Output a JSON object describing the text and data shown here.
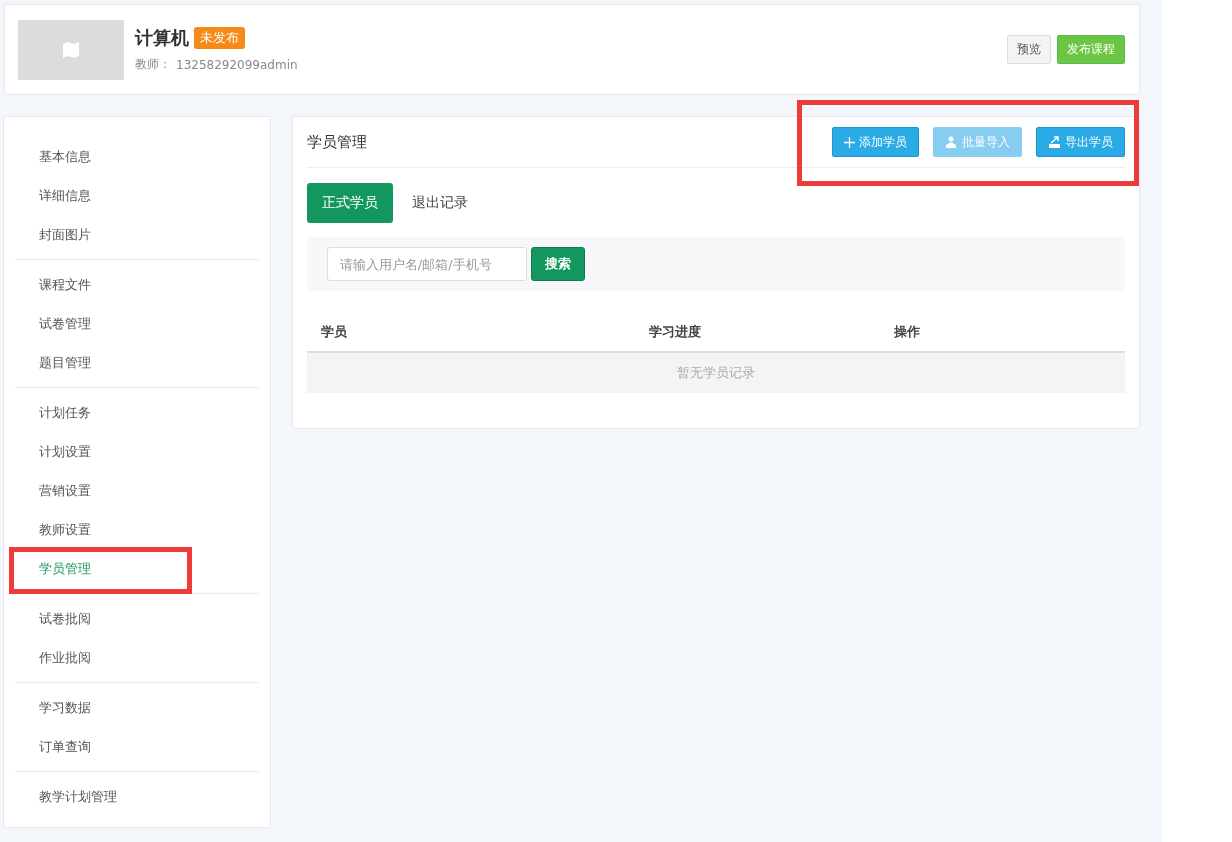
{
  "course": {
    "title": "计算机",
    "status": "未发布",
    "teacher_label": "教师：",
    "teacher": "13258292099admin"
  },
  "header_buttons": [
    {
      "label": "预览",
      "kind": "default"
    },
    {
      "label": "发布课程",
      "kind": "primary"
    }
  ],
  "sidebar": {
    "groups": [
      {
        "items": [
          {
            "label": "基本信息",
            "selected": false,
            "highlighted": false
          },
          {
            "label": "详细信息",
            "selected": false,
            "highlighted": false
          },
          {
            "label": "封面图片",
            "selected": false,
            "highlighted": false
          }
        ]
      },
      {
        "items": [
          {
            "label": "课程文件",
            "selected": false,
            "highlighted": false
          },
          {
            "label": "试卷管理",
            "selected": false,
            "highlighted": false
          },
          {
            "label": "题目管理",
            "selected": false,
            "highlighted": false
          }
        ]
      },
      {
        "items": [
          {
            "label": "计划任务",
            "selected": false,
            "highlighted": false
          },
          {
            "label": "计划设置",
            "selected": false,
            "highlighted": false
          },
          {
            "label": "营销设置",
            "selected": false,
            "highlighted": false
          },
          {
            "label": "教师设置",
            "selected": false,
            "highlighted": false
          },
          {
            "label": "学员管理",
            "selected": true,
            "highlighted": true
          }
        ]
      },
      {
        "items": [
          {
            "label": "试卷批阅",
            "selected": false,
            "highlighted": false
          },
          {
            "label": "作业批阅",
            "selected": false,
            "highlighted": false
          }
        ]
      },
      {
        "items": [
          {
            "label": "学习数据",
            "selected": false,
            "highlighted": false
          },
          {
            "label": "订单查询",
            "selected": false,
            "highlighted": false
          }
        ]
      },
      {
        "items": [
          {
            "label": "教学计划管理",
            "selected": false,
            "highlighted": false
          }
        ]
      }
    ]
  },
  "panel": {
    "title": "学员管理",
    "actions_highlighted": true,
    "actions": [
      {
        "label": "添加学员",
        "kind": "add",
        "disabled": false
      },
      {
        "label": "批量导入",
        "kind": "import",
        "disabled": true
      },
      {
        "label": "导出学员",
        "kind": "export",
        "disabled": false
      }
    ],
    "tabs": [
      {
        "label": "正式学员",
        "selected": true
      },
      {
        "label": "退出记录",
        "selected": false
      }
    ],
    "search": {
      "placeholder": "请输入用户名/邮箱/手机号",
      "button": "搜索"
    },
    "table": {
      "columns": [
        "学员",
        "学习进度",
        "操作"
      ],
      "empty": "暂无学员记录"
    }
  }
}
